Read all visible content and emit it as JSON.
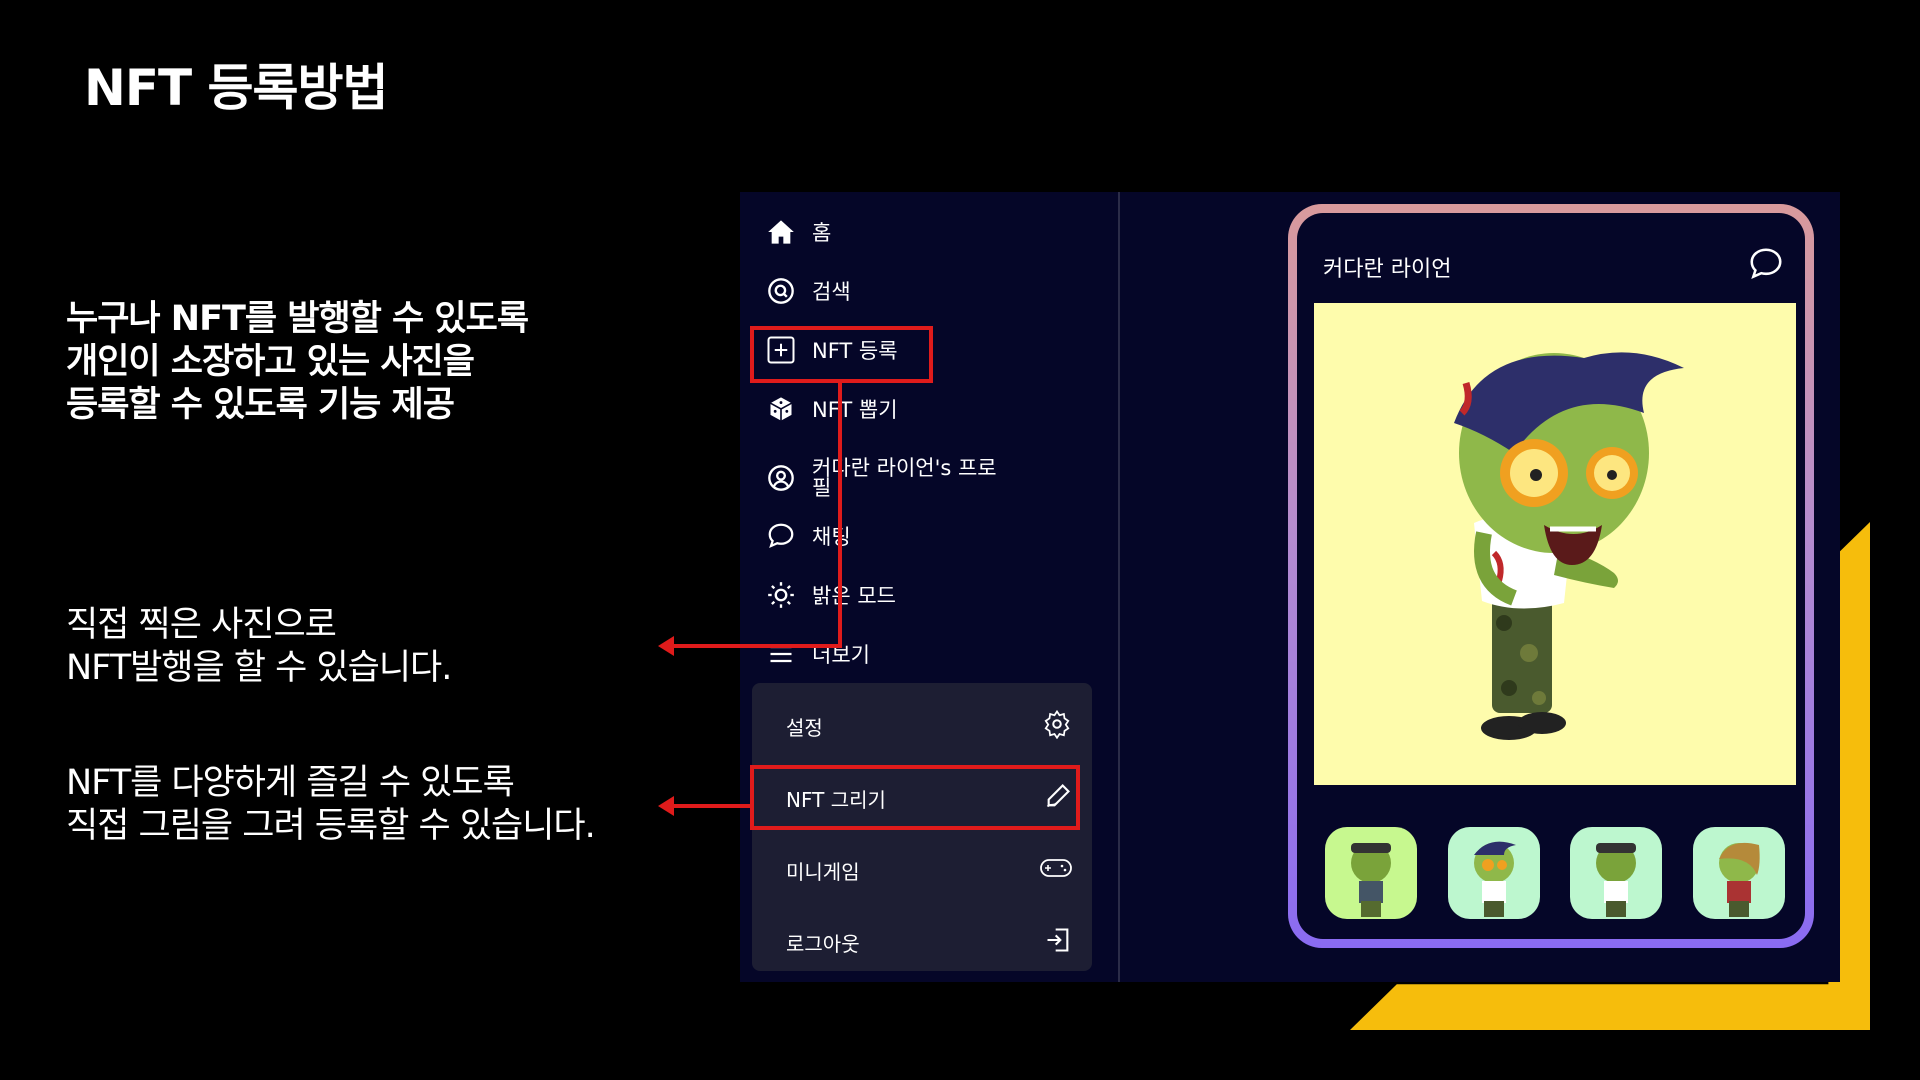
{
  "slide": {
    "title": "NFT 등록방법",
    "lead": [
      "누구나 NFT를 발행할 수 있도록",
      "개인이 소장하고 있는 사진을",
      "등록할 수 있도록 기능 제공"
    ],
    "note1": [
      "직접 찍은 사진으로",
      "NFT발행을 할 수 있습니다."
    ],
    "note2": [
      "NFT를 다양하게 즐길 수 있도록",
      "직접 그림을 그려 등록할 수 있습니다."
    ]
  },
  "sidebar": {
    "items": [
      {
        "label": "홈",
        "icon": "home-icon"
      },
      {
        "label": "검색",
        "icon": "search-icon"
      },
      {
        "label": "NFT 등록",
        "icon": "plus-square-icon"
      },
      {
        "label": "NFT 뽑기",
        "icon": "dice-icon"
      },
      {
        "label": "커다란 라이언's 프로",
        "label2": "필",
        "icon": "user-icon"
      },
      {
        "label": "채팅",
        "icon": "chat-icon"
      },
      {
        "label": "밝은 모드",
        "icon": "sun-icon"
      },
      {
        "label": "더보기",
        "icon": "menu-icon"
      }
    ],
    "submenu": [
      {
        "label": "설정",
        "icon": "gear-icon"
      },
      {
        "label": "NFT 그리기",
        "icon": "pencil-icon"
      },
      {
        "label": "미니게임",
        "icon": "gamepad-icon"
      },
      {
        "label": "로그아웃",
        "icon": "logout-icon"
      }
    ]
  },
  "card": {
    "name": "커다란 라이언",
    "chat_icon": "chat-icon",
    "image": "zombie-character-image",
    "thumbnails": [
      "zombie-thumb-1",
      "zombie-thumb-2",
      "zombie-thumb-3",
      "zombie-thumb-4"
    ]
  },
  "colors": {
    "background": "#000000",
    "app_bg": "#050628",
    "submenu_bg": "#1d1e33",
    "highlight_red": "#e01b1b",
    "accent_gold": "#f6bd0c",
    "image_bg": "#fefcac"
  }
}
